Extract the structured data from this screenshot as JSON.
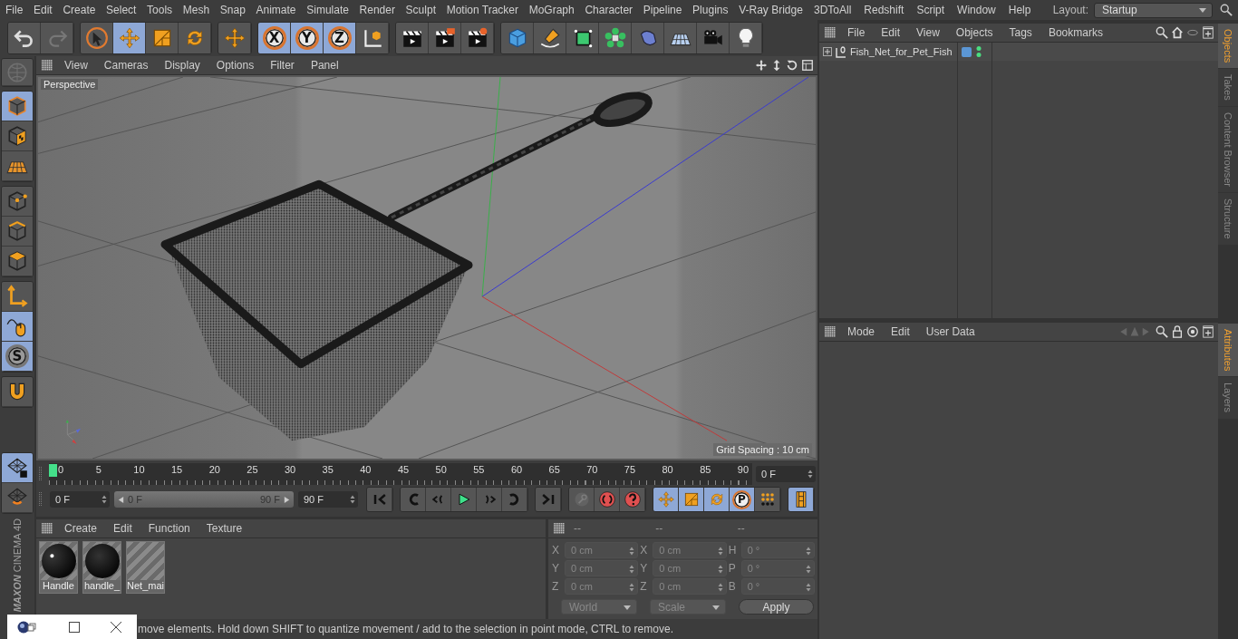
{
  "menu_bar": {
    "items": [
      "File",
      "Edit",
      "Create",
      "Select",
      "Tools",
      "Mesh",
      "Snap",
      "Animate",
      "Simulate",
      "Render",
      "Sculpt",
      "Motion Tracker",
      "MoGraph",
      "Character",
      "Pipeline",
      "Plugins",
      "V-Ray Bridge",
      "3DToAll",
      "Redshift",
      "Script",
      "Window",
      "Help"
    ],
    "layout_label": "Layout:",
    "layout_value": "Startup"
  },
  "toolbar": {
    "groups": [
      {
        "tools": [
          {
            "kind": "undo",
            "selected": false,
            "disabled": false
          },
          {
            "kind": "redo",
            "selected": false,
            "disabled": true
          }
        ]
      },
      {
        "tools": [
          {
            "kind": "select",
            "selected": false,
            "disabled": false
          },
          {
            "kind": "move",
            "selected": true,
            "disabled": false
          },
          {
            "kind": "scale",
            "selected": false,
            "disabled": false
          },
          {
            "kind": "rotate",
            "selected": false,
            "disabled": false
          }
        ]
      },
      {
        "tools": [
          {
            "kind": "transform",
            "selected": false,
            "disabled": false
          }
        ]
      },
      {
        "tools": [
          {
            "kind": "axis",
            "label": "X",
            "selected": true,
            "disabled": false
          },
          {
            "kind": "axis",
            "label": "Y",
            "selected": true,
            "disabled": false
          },
          {
            "kind": "axis",
            "label": "Z",
            "selected": true,
            "disabled": false
          },
          {
            "kind": "coord",
            "selected": false,
            "disabled": false
          }
        ]
      },
      {
        "tools": [
          {
            "kind": "render-view",
            "selected": false,
            "disabled": false
          },
          {
            "kind": "render-pic",
            "selected": false,
            "disabled": false
          },
          {
            "kind": "render-settings",
            "selected": false,
            "disabled": false
          }
        ]
      },
      {
        "tools": [
          {
            "kind": "cube",
            "selected": false,
            "disabled": false
          },
          {
            "kind": "pen",
            "selected": false,
            "disabled": false
          },
          {
            "kind": "subdivide",
            "selected": false,
            "disabled": false
          },
          {
            "kind": "cloner",
            "selected": false,
            "disabled": false
          },
          {
            "kind": "deformer",
            "selected": false,
            "disabled": false
          },
          {
            "kind": "floor",
            "selected": false,
            "disabled": false
          },
          {
            "kind": "camera",
            "selected": false,
            "disabled": false
          },
          {
            "kind": "light",
            "selected": false,
            "disabled": false
          }
        ]
      }
    ]
  },
  "left_toolbar": {
    "groups": [
      {
        "tools": [
          {
            "kind": "globe",
            "selected": false,
            "disabled": true
          }
        ]
      },
      {
        "tools": [
          {
            "kind": "model",
            "selected": true,
            "disabled": false
          },
          {
            "kind": "texture",
            "selected": false,
            "disabled": false
          },
          {
            "kind": "workplane",
            "selected": false,
            "disabled": false
          }
        ]
      },
      {
        "tools": [
          {
            "kind": "points",
            "selected": false,
            "disabled": false
          },
          {
            "kind": "edges",
            "selected": false,
            "disabled": false
          },
          {
            "kind": "polygons",
            "selected": false,
            "disabled": false
          }
        ]
      },
      {
        "tools": [
          {
            "kind": "axis-mode",
            "selected": false,
            "disabled": false
          },
          {
            "kind": "tweak",
            "selected": true,
            "disabled": false
          },
          {
            "kind": "snap",
            "label": "S",
            "selected": true,
            "disabled": false
          }
        ]
      },
      {
        "tools": [
          {
            "kind": "magnet",
            "selected": false,
            "disabled": false
          }
        ]
      },
      {
        "tools": [
          {
            "kind": "grid-lock",
            "selected": true,
            "disabled": false
          },
          {
            "kind": "grid-rotate",
            "selected": false,
            "disabled": false
          }
        ]
      }
    ],
    "logo": {
      "brand": "MAXON",
      "product": "CINEMA 4D"
    }
  },
  "viewport": {
    "menu": [
      "View",
      "Cameras",
      "Display",
      "Options",
      "Filter",
      "Panel"
    ],
    "camera": "Perspective",
    "grid_spacing": "Grid Spacing : 10 cm"
  },
  "timeline": {
    "frames": [
      "0",
      "5",
      "10",
      "15",
      "20",
      "25",
      "30",
      "35",
      "40",
      "45",
      "50",
      "55",
      "60",
      "65",
      "70",
      "75",
      "80",
      "85",
      "90"
    ],
    "playhead": {
      "level": 0
    },
    "current_frame": "0 F",
    "start_frame": "0 F",
    "range_start": "0 F",
    "range_end": "90 F",
    "end_frame": "90 F",
    "controls": [
      {
        "tools": [
          {
            "kind": "goto-start",
            "selected": false,
            "disabled": false
          }
        ]
      },
      {
        "tools": [
          {
            "kind": "prev-key",
            "selected": false,
            "disabled": false
          },
          {
            "kind": "prev-frame",
            "selected": false,
            "disabled": false
          },
          {
            "kind": "play",
            "selected": false,
            "disabled": false
          },
          {
            "kind": "next-frame",
            "selected": false,
            "disabled": false
          },
          {
            "kind": "next-key",
            "selected": false,
            "disabled": false
          }
        ]
      },
      {
        "tools": [
          {
            "kind": "goto-end",
            "selected": false,
            "disabled": false
          }
        ]
      },
      {
        "tools": [
          {
            "kind": "key",
            "selected": false,
            "disabled": true
          },
          {
            "kind": "record",
            "selected": false,
            "disabled": false
          },
          {
            "kind": "autokey",
            "selected": false,
            "disabled": false
          }
        ]
      },
      {
        "tools": [
          {
            "kind": "move",
            "selected": true,
            "disabled": false
          },
          {
            "kind": "scale",
            "selected": true,
            "disabled": false
          },
          {
            "kind": "rotate",
            "selected": true,
            "disabled": false
          },
          {
            "kind": "param",
            "label": "P",
            "selected": true,
            "disabled": false
          },
          {
            "kind": "dots",
            "selected": false,
            "disabled": false
          }
        ]
      },
      {
        "tools": [
          {
            "kind": "film",
            "selected": true,
            "disabled": false
          }
        ]
      }
    ]
  },
  "materials": {
    "menu": [
      "Create",
      "Edit",
      "Function",
      "Texture"
    ],
    "items": [
      {
        "name": "Handle",
        "kind": "glossy"
      },
      {
        "name": "handle_",
        "kind": "matte"
      },
      {
        "name": "Net_mai",
        "kind": "striped"
      }
    ]
  },
  "coordinates": {
    "headers": [
      "--",
      "--",
      "--"
    ],
    "rows": [
      [
        {
          "axis": "X",
          "value": "0 cm"
        },
        {
          "axis": "X",
          "value": "0 cm"
        },
        {
          "axis": "H",
          "value": "0 °"
        }
      ],
      [
        {
          "axis": "Y",
          "value": "0 cm"
        },
        {
          "axis": "Y",
          "value": "0 cm"
        },
        {
          "axis": "P",
          "value": "0 °"
        }
      ],
      [
        {
          "axis": "Z",
          "value": "0 cm"
        },
        {
          "axis": "Z",
          "value": "0 cm"
        },
        {
          "axis": "B",
          "value": "0 °"
        }
      ]
    ],
    "dropdowns": [
      "World",
      "Scale"
    ],
    "apply": "Apply"
  },
  "status_bar": "move elements. Hold down SHIFT to quantize movement / add to the selection in point mode, CTRL to remove.",
  "objects_panel": {
    "menu": [
      "File",
      "Edit",
      "View",
      "Objects",
      "Tags",
      "Bookmarks"
    ],
    "objects": [
      {
        "name": "Fish_Net_for_Pet_Fish",
        "expanded": false,
        "color": "#5b96d4"
      }
    ]
  },
  "attributes_panel": {
    "menu": [
      "Mode",
      "Edit",
      "User Data"
    ]
  },
  "side_tabs": {
    "upper": [
      {
        "label": "Objects",
        "selected": true
      },
      {
        "label": "Takes",
        "selected": false
      },
      {
        "label": "Content Browser",
        "selected": false
      },
      {
        "label": "Structure",
        "selected": false
      }
    ],
    "lower": [
      {
        "label": "Attributes",
        "selected": true
      },
      {
        "label": "Layers",
        "selected": false
      }
    ]
  }
}
